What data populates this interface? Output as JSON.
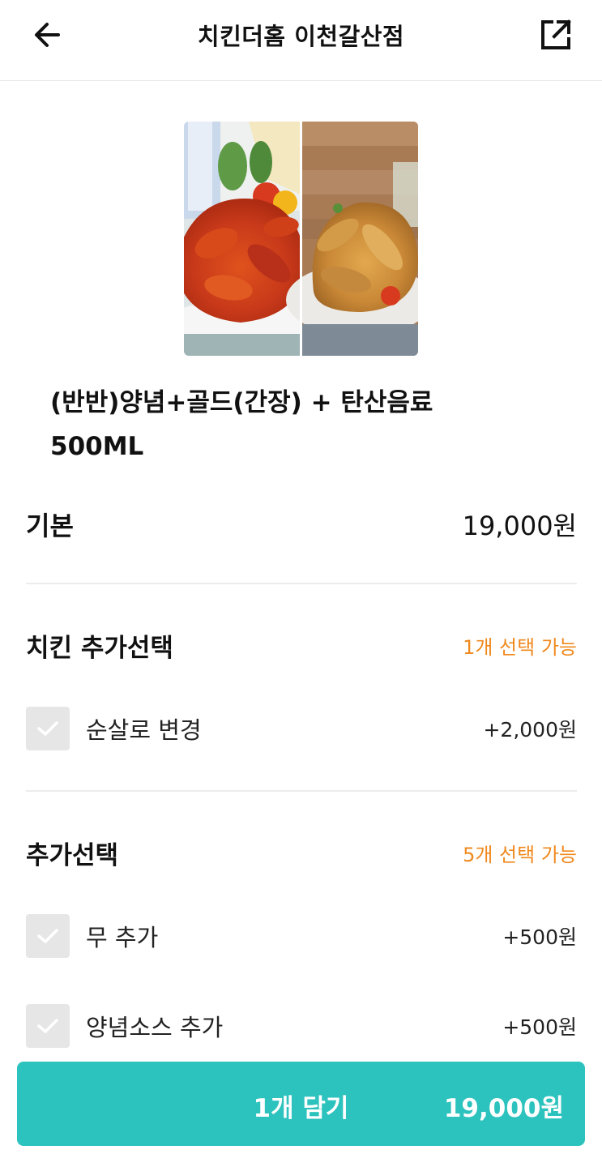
{
  "header": {
    "title": "치킨더홈 이천갈산점",
    "back_icon": "arrow-left-icon",
    "share_icon": "share-external-icon"
  },
  "product": {
    "name_line1": "(반반)양념+골드(간장) + 탄산음료",
    "name_line2": "500ML"
  },
  "base": {
    "label": "기본",
    "price": "19,000원"
  },
  "sections": [
    {
      "title": "치킨 추가선택",
      "hint": "1개 선택 가능",
      "options": [
        {
          "label": "순살로 변경",
          "price": "+2,000원",
          "checked": false
        }
      ]
    },
    {
      "title": "추가선택",
      "hint": "5개 선택 가능",
      "options": [
        {
          "label": "무 추가",
          "price": "+500원",
          "checked": false
        },
        {
          "label": "양념소스 추가",
          "price": "+500원",
          "checked": false
        }
      ]
    }
  ],
  "cart": {
    "label": "1개 담기",
    "total": "19,000원"
  },
  "colors": {
    "accent_teal": "#2cc2bd",
    "hint_orange": "#f0891e",
    "checkbox_gray": "#e6e6e6"
  }
}
